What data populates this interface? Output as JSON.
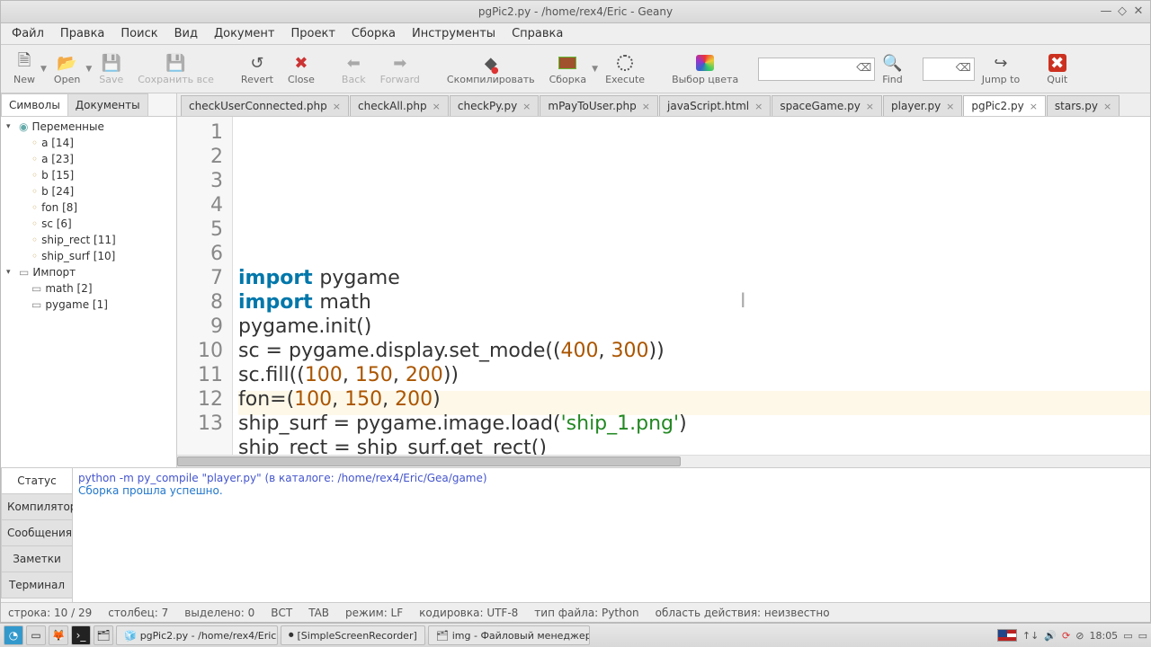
{
  "title": "pgPic2.py - /home/rex4/Eric - Geany",
  "menus": [
    "Файл",
    "Правка",
    "Поиск",
    "Вид",
    "Документ",
    "Проект",
    "Сборка",
    "Инструменты",
    "Справка"
  ],
  "toolbar": {
    "new": "New",
    "open": "Open",
    "save": "Save",
    "saveall": "Сохранить все",
    "revert": "Revert",
    "close": "Close",
    "back": "Back",
    "forward": "Forward",
    "compile": "Скомпилировать",
    "build": "Сборка",
    "execute": "Execute",
    "color": "Выбор цвета",
    "find": "Find",
    "jump": "Jump to",
    "quit": "Quit"
  },
  "sidetabs": {
    "symbols": "Символы",
    "documents": "Документы"
  },
  "symbols": {
    "vars": "Переменные",
    "varlist": [
      "a [14]",
      "a [23]",
      "b [15]",
      "b [24]",
      "fon [8]",
      "sc [6]",
      "ship_rect [11]",
      "ship_surf [10]"
    ],
    "import": "Импорт",
    "importlist": [
      "math [2]",
      "pygame [1]"
    ]
  },
  "edtabs": [
    "checkUserConnected.php",
    "checkAll.php",
    "checkPy.py",
    "mPayToUser.php",
    "javaScript.html",
    "spaceGame.py",
    "player.py",
    "pgPic2.py",
    "stars.py"
  ],
  "edtab_active": 7,
  "code": {
    "lines": [
      [
        {
          "t": "import ",
          "c": "kw"
        },
        {
          "t": "pygame"
        }
      ],
      [
        {
          "t": "import ",
          "c": "kw"
        },
        {
          "t": "math"
        }
      ],
      [
        {
          "t": ""
        }
      ],
      [
        {
          "t": "pygame.init()"
        }
      ],
      [
        {
          "t": ""
        }
      ],
      [
        {
          "t": "sc = pygame.display.set_mode(("
        },
        {
          "t": "400",
          "c": "num"
        },
        {
          "t": ", "
        },
        {
          "t": "300",
          "c": "num"
        },
        {
          "t": "))"
        }
      ],
      [
        {
          "t": "sc.fill(("
        },
        {
          "t": "100",
          "c": "num"
        },
        {
          "t": ", "
        },
        {
          "t": "150",
          "c": "num"
        },
        {
          "t": ", "
        },
        {
          "t": "200",
          "c": "num"
        },
        {
          "t": "))"
        }
      ],
      [
        {
          "t": "fon=("
        },
        {
          "t": "100",
          "c": "num"
        },
        {
          "t": ", "
        },
        {
          "t": "150",
          "c": "num"
        },
        {
          "t": ", "
        },
        {
          "t": "200",
          "c": "num"
        },
        {
          "t": ")"
        }
      ],
      [
        {
          "t": ""
        }
      ],
      [
        {
          "t": "ship_surf = pygame.image.load("
        },
        {
          "t": "'ship_1.png'",
          "c": "str"
        },
        {
          "t": ")"
        }
      ],
      [
        {
          "t": "ship_rect = ship_surf.get_rect()"
        }
      ],
      [
        {
          "t": ""
        }
      ],
      [
        {
          "t": "#"
        }
      ]
    ],
    "total": 13
  },
  "msgtabs": [
    "Статус",
    "Компилятор",
    "Сообщения",
    "Заметки",
    "Терминал"
  ],
  "messages": {
    "l1": "python -m py_compile \"player.py\" (в каталоге: /home/rex4/Eric/Gea/game)",
    "l2": "Сборка прошла успешно."
  },
  "status": {
    "line": "строка: 10 / 29",
    "col": "столбец: 7",
    "sel": "выделено: 0",
    "ins": "ВСТ",
    "tab": "TAB",
    "mode": "режим: LF",
    "enc": "кодировка: UTF-8",
    "ftype": "тип файла: Python",
    "scope": "область действия: неизвестно"
  },
  "taskbar": {
    "app1": "pgPic2.py - /home/rex4/Eric -...",
    "app2": "[SimpleScreenRecorder]",
    "app3": "img - Файловый менеджер",
    "time": "18:05"
  }
}
